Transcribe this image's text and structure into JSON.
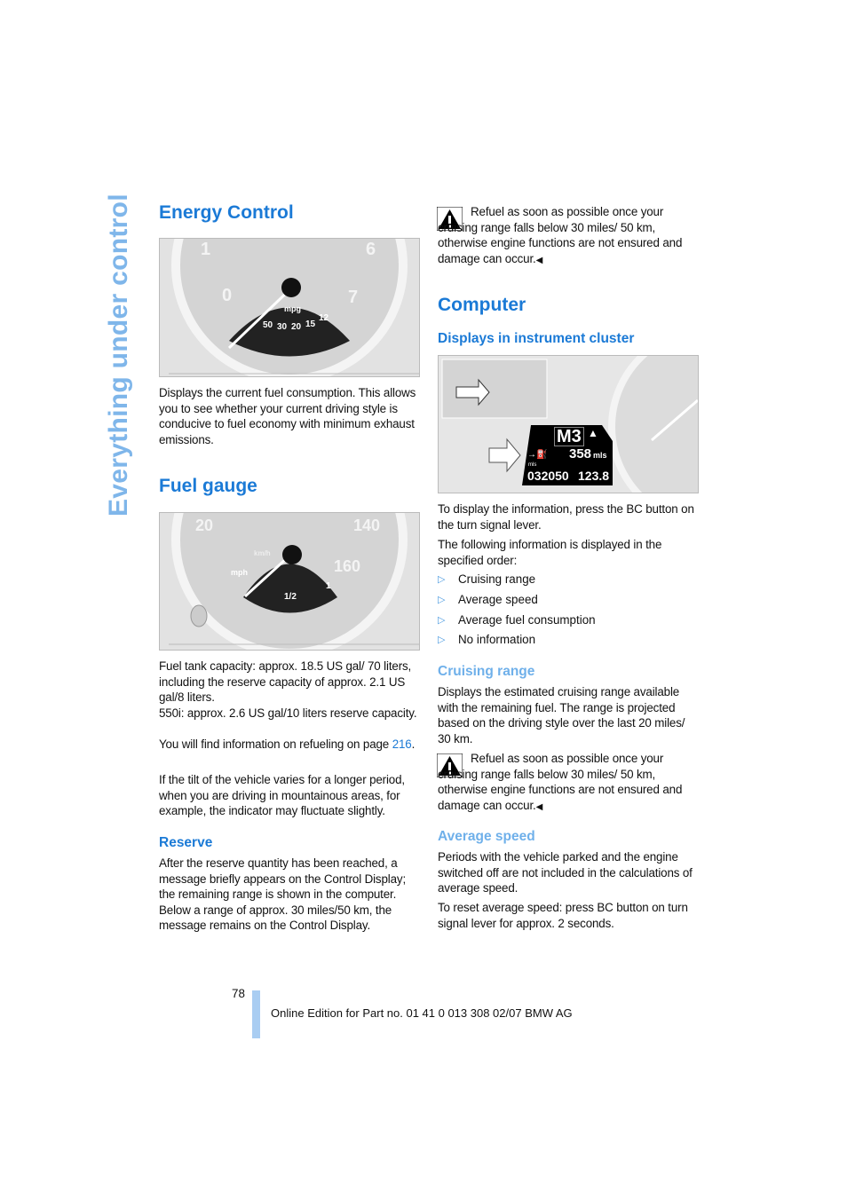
{
  "side_title": "Everything under control",
  "left": {
    "energy": {
      "title": "Energy Control",
      "figure": {
        "labels": [
          "mpg",
          "50",
          "30",
          "20",
          "15",
          "12",
          "0",
          "7",
          "6",
          "1"
        ]
      },
      "text": "Displays the current fuel consumption. This allows you to see whether your current driving style is conducive to fuel economy with minimum exhaust emissions."
    },
    "fuel": {
      "title": "Fuel gauge",
      "figure": {
        "labels": [
          "20",
          "140",
          "160",
          "mph",
          "km/h",
          "1/2",
          "1"
        ]
      },
      "text1": "Fuel tank capacity: approx. 18.5 US gal/ 70 liters, including the reserve capacity of approx. 2.1 US gal/8 liters.",
      "text2": "550i: approx. 2.6 US gal/10 liters reserve capacity.",
      "text3_pre": "You will find information on refueling on page ",
      "text3_link": "216",
      "text3_post": ".",
      "text4": "If the tilt of the vehicle varies for a longer period, when you are driving in mountainous areas, for example, the indicator may fluctuate slightly."
    },
    "reserve": {
      "title": "Reserve",
      "text": "After the reserve quantity has been reached, a message briefly appears on the Control Display; the remaining range is shown in the computer. Below a range of approx. 30 miles/50 km, the message remains on the Control Display."
    }
  },
  "right": {
    "warning1": "Refuel as soon as possible once your cruising range falls below 30 miles/ 50 km, otherwise engine functions are not ensured and damage can occur.",
    "computer_title": "Computer",
    "displays_title": "Displays in instrument cluster",
    "display": {
      "mode": "M3",
      "range": "358",
      "range_unit": "mls",
      "odo_unit": "mls",
      "odometer": "032050",
      "trip": "123.8"
    },
    "text1": "To display the information, press the BC button on the turn signal lever.",
    "text2": "The following information is displayed in the specified order:",
    "bullets": [
      "Cruising range",
      "Average speed",
      "Average fuel consumption",
      "No information"
    ],
    "cruising": {
      "title": "Cruising range",
      "text": "Displays the estimated cruising range available with the remaining fuel. The range is projected based on the driving style over the last 20 miles/ 30 km.",
      "warning": "Refuel as soon as possible once your cruising range falls below 30 miles/ 50 km, otherwise engine functions are not ensured and damage can occur."
    },
    "avg": {
      "title": "Average speed",
      "text1": "Periods with the vehicle parked and the engine switched off are not included in the calculations of average speed.",
      "text2": "To reset average speed: press BC button on turn signal lever for approx. 2 seconds."
    }
  },
  "footer": {
    "page": "78",
    "edition": "Online Edition for Part no. 01 41 0 013 308 02/07 BMW AG"
  }
}
